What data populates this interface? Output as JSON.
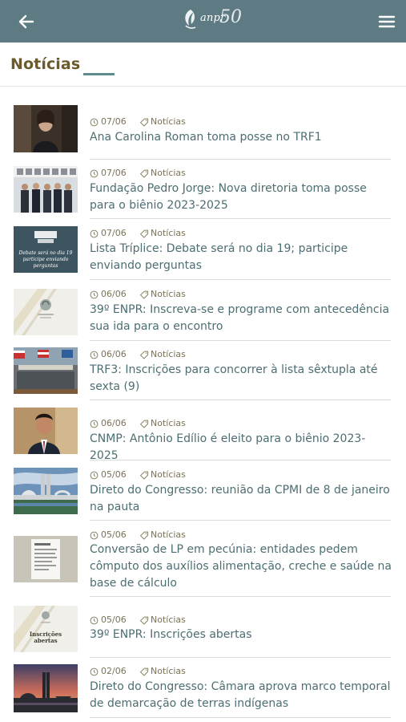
{
  "header": {
    "brand": "anpr",
    "brand_number": "50",
    "back_icon": "arrow-left-icon",
    "menu_icon": "hamburger-menu-icon",
    "background_color": "#5e7b84"
  },
  "page": {
    "title": "Notícias",
    "title_color": "#6b5a2b",
    "accent_color": "#5f8a8e"
  },
  "news": [
    {
      "date": "07/06",
      "category": "Notícias",
      "title": "Ana Carolina Roman toma posse no TRF1"
    },
    {
      "date": "07/06",
      "category": "Notícias",
      "title": "Fundação Pedro Jorge: Nova diretoria toma posse para o biênio 2023-2025"
    },
    {
      "date": "07/06",
      "category": "Notícias",
      "title": "Lista Tríplice: Debate será no dia 19; participe enviando perguntas",
      "thumb_text": [
        "Debate será no dia 19",
        "participe enviando perguntas"
      ]
    },
    {
      "date": "06/06",
      "category": "Notícias",
      "title": "39º ENPR: Inscreva-se e programe com antecedência sua ida para o encontro"
    },
    {
      "date": "06/06",
      "category": "Notícias",
      "title": "TRF3: Inscrições para concorrer à lista sêxtupla até sexta (9)"
    },
    {
      "date": "06/06",
      "category": "Notícias",
      "title": "CNMP: Antônio Edílio é eleito para o biênio 2023-2025"
    },
    {
      "date": "05/06",
      "category": "Notícias",
      "title": "Direto do Congresso: reunião da CPMI de 8 de janeiro na pauta"
    },
    {
      "date": "05/06",
      "category": "Notícias",
      "title": "Conversão de LP em pecúnia: entidades pedem cômputo dos auxílios alimentação, creche e saúde na base de cálculo"
    },
    {
      "date": "05/06",
      "category": "Notícias",
      "title": "39º ENPR: Inscrições abertas",
      "thumb_text": [
        "Inscrições",
        "abertas"
      ]
    },
    {
      "date": "02/06",
      "category": "Notícias",
      "title": "Direto do Congresso: Câmara aprova marco temporal de demarcação de terras indígenas"
    }
  ],
  "icons": {
    "date": "clock-icon",
    "category": "tag-icon"
  }
}
